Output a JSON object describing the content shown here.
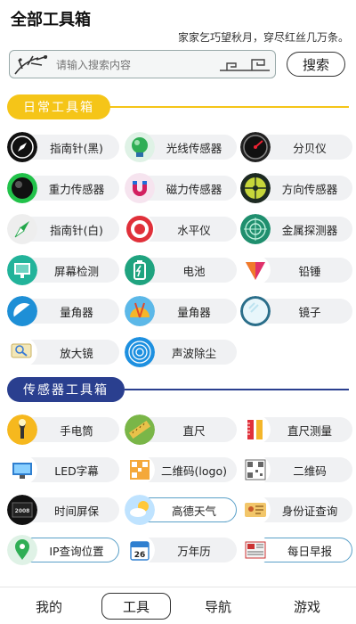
{
  "header": {
    "title": "全部工具箱",
    "poem": "家家乞巧望秋月，穿尽红丝几万条。"
  },
  "search": {
    "placeholder": "请输入搜索内容",
    "button_label": "搜索"
  },
  "sections": [
    {
      "title": "日常工具箱",
      "accent": "#f5c518"
    },
    {
      "title": "传感器工具箱",
      "accent": "#2a3f8f"
    }
  ],
  "daily_tools": [
    {
      "label": "指南针(黑)",
      "icon": "compass-black-icon"
    },
    {
      "label": "光线传感器",
      "icon": "light-sensor-icon"
    },
    {
      "label": "分贝仪",
      "icon": "decibel-meter-icon"
    },
    {
      "label": "重力传感器",
      "icon": "gravity-sensor-icon"
    },
    {
      "label": "磁力传感器",
      "icon": "magnet-icon"
    },
    {
      "label": "方向传感器",
      "icon": "direction-sensor-icon"
    },
    {
      "label": "指南针(白)",
      "icon": "compass-white-icon"
    },
    {
      "label": "水平仪",
      "icon": "level-target-icon"
    },
    {
      "label": "金属探测器",
      "icon": "metal-detector-icon"
    },
    {
      "label": "屏幕检测",
      "icon": "screen-test-icon"
    },
    {
      "label": "电池",
      "icon": "battery-icon"
    },
    {
      "label": "铅锤",
      "icon": "plumb-bob-icon"
    },
    {
      "label": "量角器",
      "icon": "protractor-icon"
    },
    {
      "label": "量角器",
      "icon": "protractor-ruler-icon"
    },
    {
      "label": "镜子",
      "icon": "mirror-icon"
    },
    {
      "label": "放大镜",
      "icon": "magnifier-icon"
    },
    {
      "label": "声波除尘",
      "icon": "sound-wave-icon"
    }
  ],
  "sensor_tools": [
    {
      "label": "手电筒",
      "icon": "flashlight-icon"
    },
    {
      "label": "直尺",
      "icon": "ruler-icon"
    },
    {
      "label": "直尺测量",
      "icon": "ruler-measure-icon"
    },
    {
      "label": "LED字幕",
      "icon": "led-monitor-icon"
    },
    {
      "label": "二维码(logo)",
      "icon": "qrcode-logo-icon"
    },
    {
      "label": "二维码",
      "icon": "qrcode-icon"
    },
    {
      "label": "时间屏保",
      "icon": "clock-screensaver-icon"
    },
    {
      "label": "高德天气",
      "icon": "weather-icon"
    },
    {
      "label": "身份证查询",
      "icon": "id-card-icon"
    },
    {
      "label": "IP查询位置",
      "icon": "location-pin-icon"
    },
    {
      "label": "万年历",
      "icon": "calendar-icon"
    },
    {
      "label": "每日早报",
      "icon": "newspaper-icon"
    }
  ],
  "calendar_day": "26",
  "clock_text": "2008",
  "tabs": [
    {
      "label": "我的",
      "active": false
    },
    {
      "label": "工具",
      "active": true
    },
    {
      "label": "导航",
      "active": false
    },
    {
      "label": "游戏",
      "active": false
    }
  ]
}
